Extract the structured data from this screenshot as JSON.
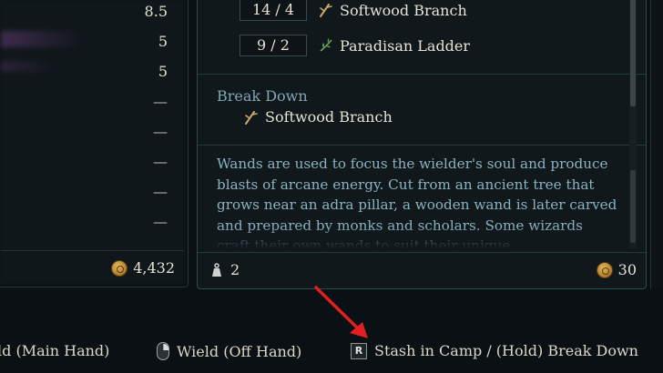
{
  "left_panel": {
    "stats": [
      "8.5",
      "5",
      "5",
      "—",
      "—",
      "—",
      "—",
      "—"
    ],
    "gold": "4,432"
  },
  "recipe": {
    "ingredients": [
      {
        "qty": "14 / 4",
        "name": "Softwood Branch",
        "icon": "branch-icon"
      },
      {
        "qty": "9 / 2",
        "name": "Paradisan Ladder",
        "icon": "herb-icon"
      }
    ]
  },
  "breakdown": {
    "title": "Break Down",
    "item": {
      "name": "Softwood Branch",
      "icon": "branch-icon"
    }
  },
  "description": "Wands are used to focus the wielder's soul and produce blasts of arcane energy. Cut from an ancient tree that grows near an adra pillar, a wooden wand is later carved and prepared by monks and scholars. Some wizards craft their own wands to suit their unique",
  "item_footer": {
    "weight": "2",
    "price": "30"
  },
  "hints": {
    "main_hand": "ld (Main Hand)",
    "off_hand": "Wield (Off Hand)",
    "key": "R",
    "stash": "Stash in Camp / (Hold) Break Down"
  },
  "colors": {
    "accent_text": "#8ab3c0",
    "section_title": "#7fa8b4",
    "arrow": "#e02020",
    "panel_border": "#2a4a4c"
  }
}
